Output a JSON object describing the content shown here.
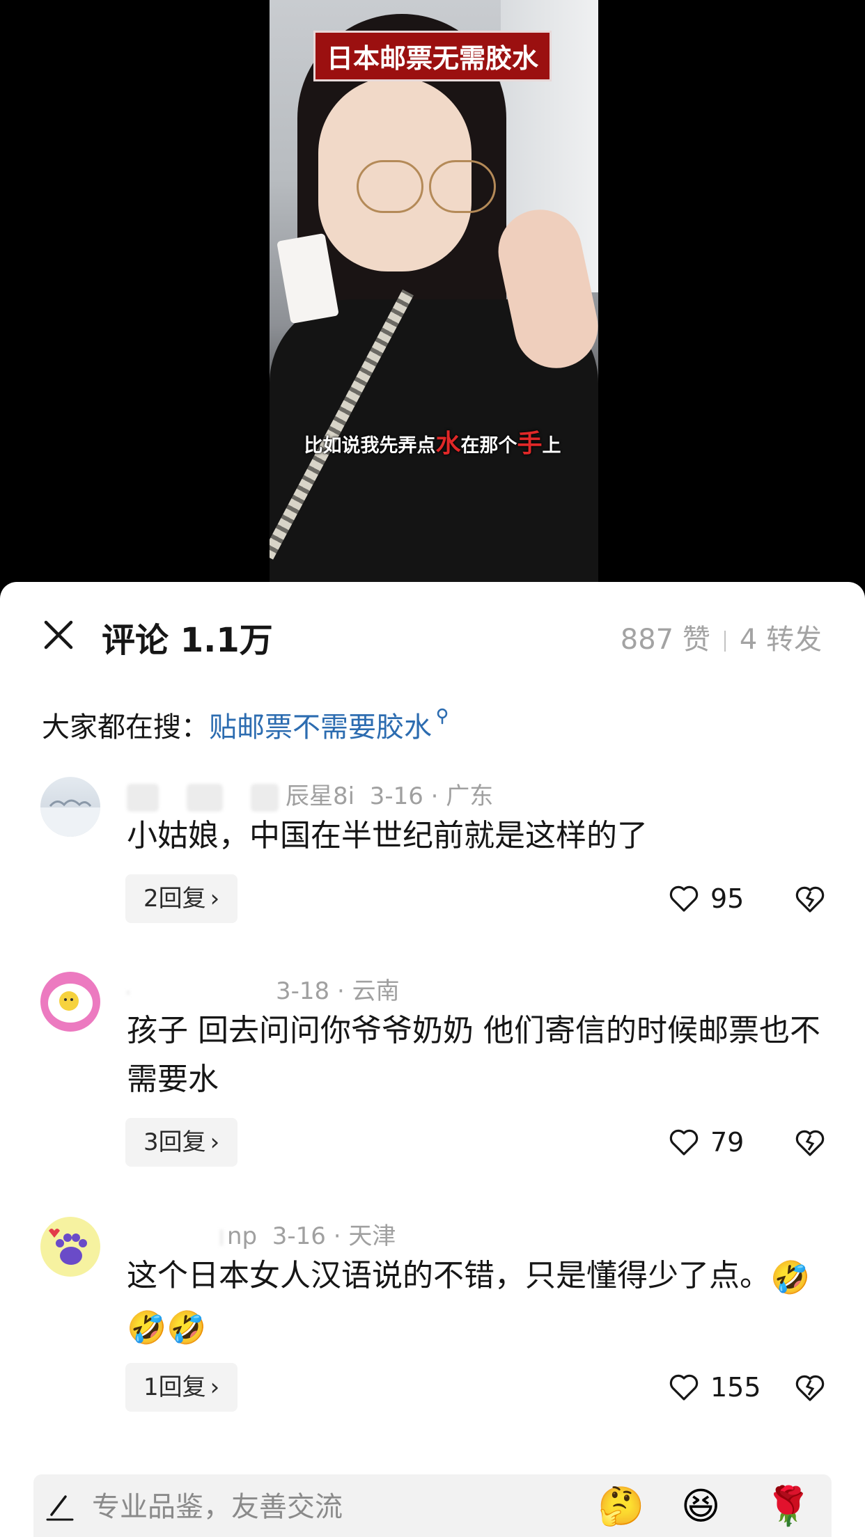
{
  "video": {
    "title": "日本邮票无需胶水",
    "subtitle_parts": [
      "比如说我先弄点",
      "水",
      "在那个",
      "手",
      "上"
    ]
  },
  "header": {
    "title": "评论 1.1万",
    "likes": "887 赞",
    "shares": "4 转发"
  },
  "search": {
    "prefix": "大家都在搜：",
    "query": "贴邮票不需要胶水"
  },
  "comments": [
    {
      "user_suffix": "辰星8i",
      "date": "3-16 · 广东",
      "text": "小姑娘，中国在半世纪前就是这样的了",
      "replies": "2回复",
      "likes": "95"
    },
    {
      "user_suffix": "",
      "date": "3-18 · 云南",
      "text": "孩子 回去问问你爷爷奶奶 他们寄信的时候邮票也不需要水",
      "replies": "3回复",
      "likes": "79"
    },
    {
      "user_suffix": "np",
      "date": "3-16 · 天津",
      "text": "这个日本女人汉语说的不错，只是懂得少了点。",
      "emojis": [
        "🤣",
        "🤣",
        "🤣"
      ],
      "replies": "1回复",
      "likes": "155"
    }
  ],
  "input": {
    "placeholder": "专业品鉴，友善交流",
    "emoji_buttons": [
      "🤔",
      "😆",
      "🌹"
    ]
  },
  "icons": {
    "close": "close-icon",
    "like": "heart-outline-icon",
    "dislike": "broken-heart-icon",
    "search_hint": "search-icon",
    "pen": "pen-icon"
  }
}
